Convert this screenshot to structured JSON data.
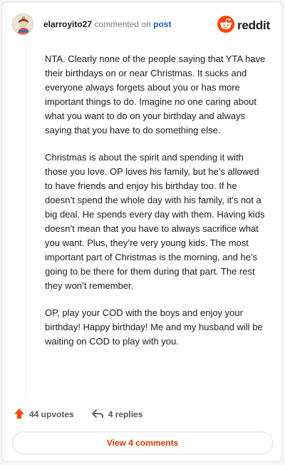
{
  "comment": {
    "username": "elarroyito27",
    "action_text": "commented on",
    "post_link": "post",
    "paragraphs": [
      "NTA. Clearly none of the people saying that YTA have their birthdays on or near Christmas. It sucks and everyone always forgets about you or has more important things to do. Imagine no one caring about what you want to do on your birthday and always saying that you have to do something else.",
      "Christmas is about the spirit and spending it with those you love. OP loves his family, but he’s allowed to have friends and enjoy his birthday too. If he doesn’t spend the whole day with his family, it’s not a big deal. He spends every day with them. Having kids doesn’t mean that you have to always sacrifice what you want. Plus, they’re very young kids. The most important part of Christmas is the morning, and he’s going to be there for them during that part. The rest they won’t remember.",
      "OP, play your COD with the boys and enjoy your birthday! Happy birthday! Me and my husband will be waiting on COD to play with you."
    ]
  },
  "brand": {
    "name": "reddit",
    "icon": "reddit-logo-icon",
    "color": "#ff4500"
  },
  "avatar": {
    "icon": "user-avatar-icon"
  },
  "actions": {
    "upvotes": "44 upvotes",
    "replies": "4 replies",
    "upvote_icon": "upvote-arrow-icon",
    "reply_icon": "reply-arrow-icon",
    "upvote_color": "#ff4500"
  },
  "footer": {
    "view_comments": "View 4 comments",
    "accent": "#d93a00"
  }
}
